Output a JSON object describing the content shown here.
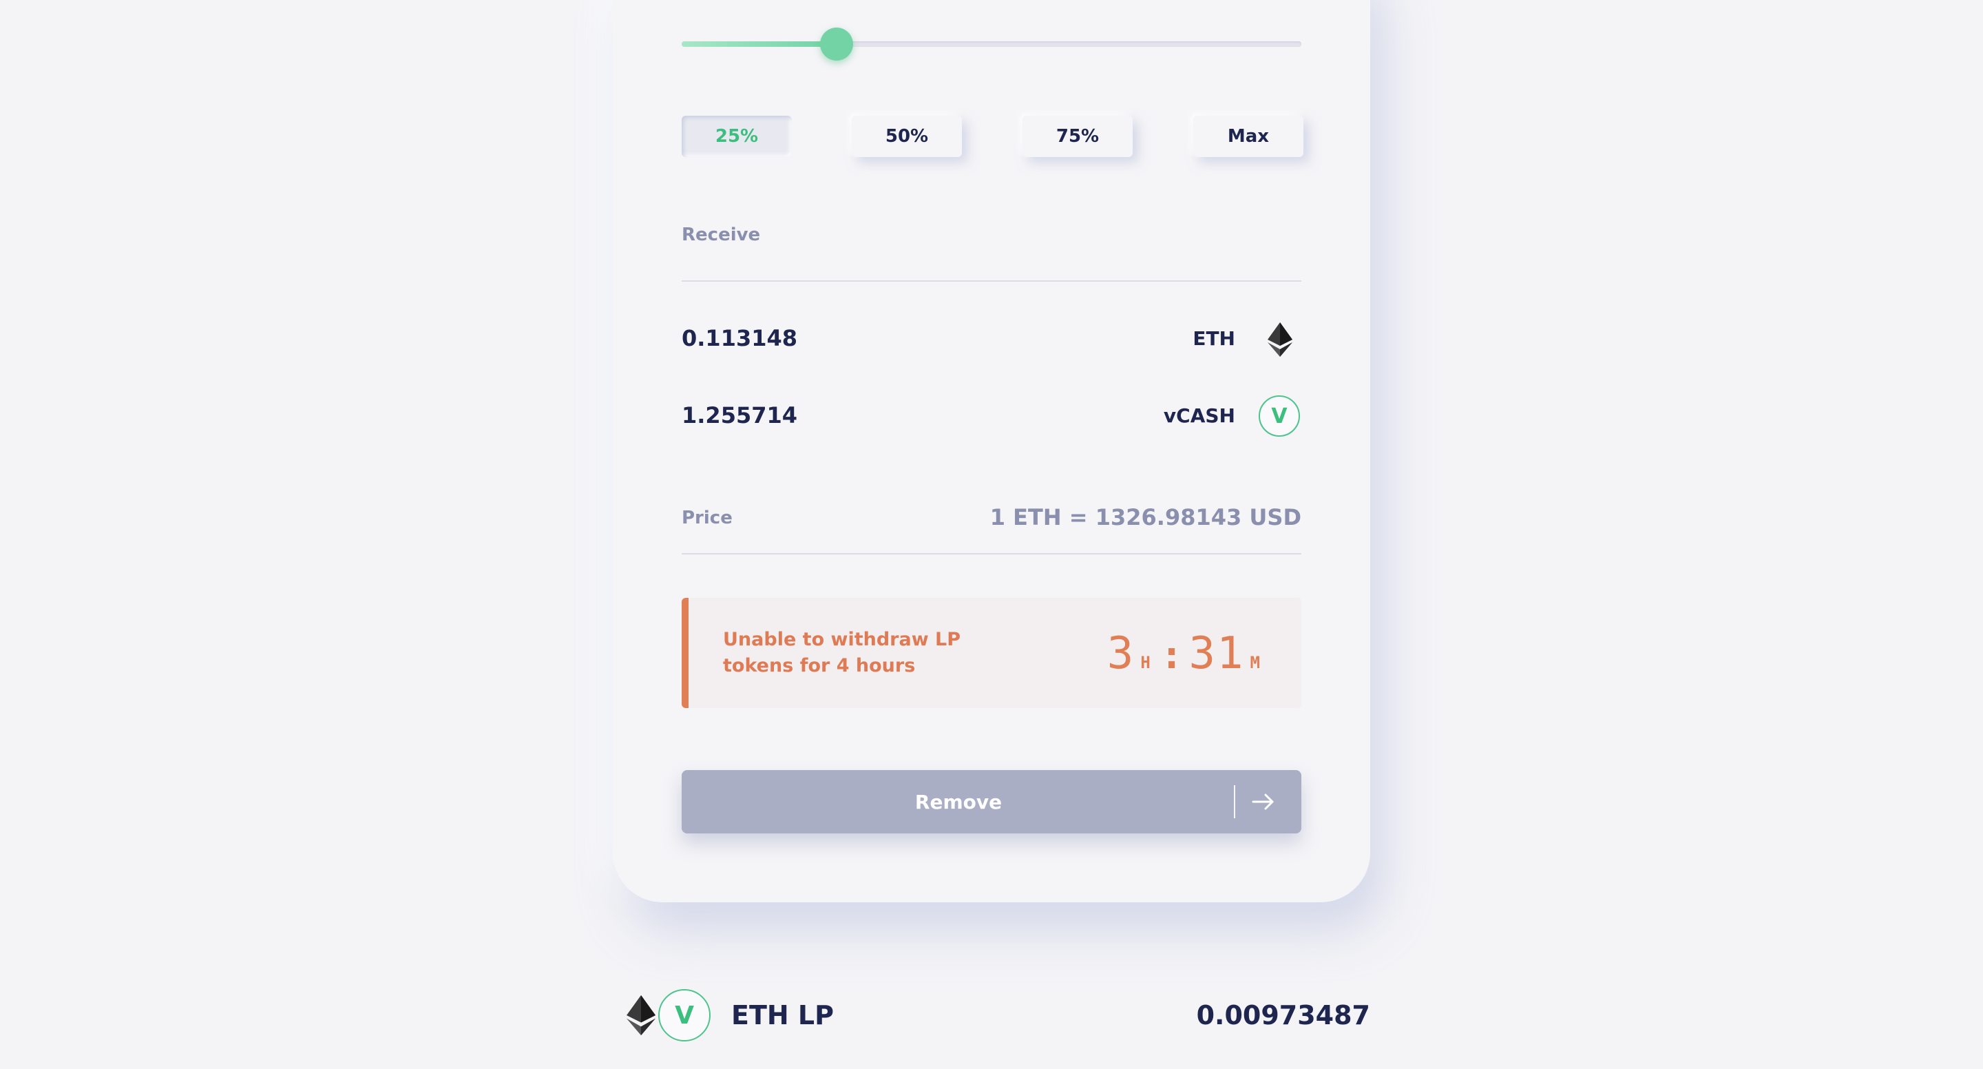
{
  "slider": {
    "value_percent": 25
  },
  "percent_buttons": [
    {
      "label": "25%",
      "active": true
    },
    {
      "label": "50%",
      "active": false
    },
    {
      "label": "75%",
      "active": false
    },
    {
      "label": "Max",
      "active": false
    }
  ],
  "receive": {
    "label": "Receive",
    "tokens": [
      {
        "amount": "0.113148",
        "symbol": "ETH",
        "icon": "ethereum-icon"
      },
      {
        "amount": "1.255714",
        "symbol": "vCASH",
        "icon": "vcash-icon",
        "icon_glyph": "V"
      }
    ]
  },
  "price": {
    "label": "Price",
    "value": "1 ETH = 1326.98143 USD"
  },
  "warning": {
    "text": "Unable to withdraw LP tokens for 4 hours",
    "hours": "3",
    "hours_unit": "H",
    "separator": ":",
    "minutes": "31",
    "minutes_unit": "M"
  },
  "remove_button": {
    "label": "Remove",
    "icon": "arrow-right-icon"
  },
  "lp_row": {
    "name": "ETH LP",
    "value": "0.00973487"
  },
  "colors": {
    "accent_green": "#4cc48c",
    "warning_orange": "#e07f56",
    "text_dark": "#1e2650",
    "text_muted": "#8a8fae",
    "disabled_button": "#a9aec4"
  }
}
